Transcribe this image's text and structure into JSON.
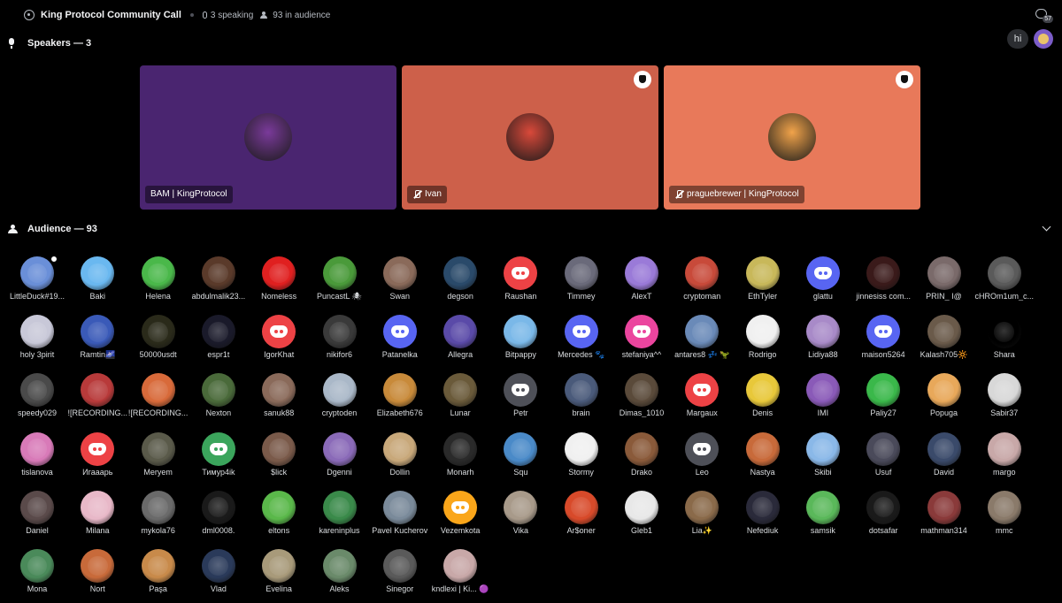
{
  "header": {
    "title": "King Protocol Community Call",
    "speaking": "3 speaking",
    "audience": "93 in audience",
    "threads_badge": "57"
  },
  "speakers": {
    "heading": "Speakers — 3",
    "hi_label": "hi",
    "tiles": [
      {
        "name": "BAM | KingProtocol",
        "muted": false,
        "moderator": false,
        "bg": "#4a2570",
        "avatar": "#7a3a9a"
      },
      {
        "name": "Ivan",
        "muted": true,
        "moderator": true,
        "bg": "#cd604a",
        "avatar": "#d9493a"
      },
      {
        "name": "praguebrewer | KingProtocol",
        "muted": true,
        "moderator": true,
        "bg": "#e8795a",
        "avatar": "#f1a34a"
      }
    ]
  },
  "audience": {
    "heading": "Audience — 93",
    "members": [
      {
        "name": "LittleDuck#19...",
        "color": "#6a8fd8",
        "discord": false
      },
      {
        "name": "Baki",
        "color": "#6ab8f0",
        "discord": false
      },
      {
        "name": "Helena",
        "color": "#4ab84a",
        "discord": false
      },
      {
        "name": "abdulmalik23...",
        "color": "#5a3a2a",
        "discord": false
      },
      {
        "name": "Nomeless",
        "color": "#e02020",
        "discord": false
      },
      {
        "name": "PuncastL 🕷",
        "color": "#4a9a3a",
        "discord": false
      },
      {
        "name": "Swan",
        "color": "#8a6a5a",
        "discord": false
      },
      {
        "name": "degson",
        "color": "#2a4a6a",
        "discord": false
      },
      {
        "name": "Raushan",
        "color": "#ed4245",
        "discord": true
      },
      {
        "name": "Timmey",
        "color": "#6a6a7a",
        "discord": false
      },
      {
        "name": "AlexT",
        "color": "#9a7ad8",
        "discord": false
      },
      {
        "name": "cryptoman",
        "color": "#c84a3a",
        "discord": false
      },
      {
        "name": "EthTyler",
        "color": "#c8b85a",
        "discord": false
      },
      {
        "name": "glattu",
        "color": "#5865f2",
        "discord": true
      },
      {
        "name": "jinnesiss com...",
        "color": "#3a1a1a",
        "discord": false
      },
      {
        "name": "PRIN_ I@",
        "color": "#7a6a6a",
        "discord": false
      },
      {
        "name": "cHROm1um_c...",
        "color": "#5a5a5a",
        "discord": false
      },
      {
        "name": "holy 3pirit",
        "color": "#c8c8d8",
        "discord": false
      },
      {
        "name": "Ramtin🌌",
        "color": "#3a5ab8",
        "discord": false
      },
      {
        "name": "50000usdt",
        "color": "#2a2a1a",
        "discord": false
      },
      {
        "name": "espr1t",
        "color": "#1a1a2a",
        "discord": false
      },
      {
        "name": "IgorKhat",
        "color": "#ed4245",
        "discord": true
      },
      {
        "name": "nikifor6",
        "color": "#3a3a3a",
        "discord": false
      },
      {
        "name": "Patanelka",
        "color": "#5865f2",
        "discord": true
      },
      {
        "name": "Allegra",
        "color": "#5a4aa8",
        "discord": false
      },
      {
        "name": "Bitpappy",
        "color": "#7ab8e8",
        "discord": false
      },
      {
        "name": "Mercedes 🐾",
        "color": "#5865f2",
        "discord": true
      },
      {
        "name": "stefaniya^^",
        "color": "#eb459e",
        "discord": true
      },
      {
        "name": "antares8 💤 🦖",
        "color": "#6a8ab8",
        "discord": false
      },
      {
        "name": "Rodrigo",
        "color": "#f0f0f0",
        "discord": false
      },
      {
        "name": "Lidiya88",
        "color": "#a88ac8",
        "discord": false
      },
      {
        "name": "maison5264",
        "color": "#5865f2",
        "discord": true
      },
      {
        "name": "Kalash705🔆",
        "color": "#6a5a4a",
        "discord": false
      },
      {
        "name": "Shara",
        "color": "#000000",
        "discord": false
      },
      {
        "name": "speedy029",
        "color": "#4a4a4a",
        "discord": false
      },
      {
        "name": "![RECORDING...",
        "color": "#b83a3a",
        "discord": false
      },
      {
        "name": "![RECORDING...",
        "color": "#d86a3a",
        "discord": false
      },
      {
        "name": "Nexton",
        "color": "#4a6a3a",
        "discord": false
      },
      {
        "name": "sanuk88",
        "color": "#8a6a5a",
        "discord": false
      },
      {
        "name": "cryptoden",
        "color": "#aab8c8",
        "discord": false
      },
      {
        "name": "Elizabeth676",
        "color": "#c88a3a",
        "discord": false
      },
      {
        "name": "Lunar",
        "color": "#6a5a3a",
        "discord": false
      },
      {
        "name": "Petr",
        "color": "#4e5058",
        "discord": true
      },
      {
        "name": "brain",
        "color": "#4a5a7a",
        "discord": false
      },
      {
        "name": "Dimas_1010",
        "color": "#5a4a3a",
        "discord": false
      },
      {
        "name": "Margaux",
        "color": "#ed4245",
        "discord": true
      },
      {
        "name": "Denis",
        "color": "#e8c83a",
        "discord": false
      },
      {
        "name": "IMI",
        "color": "#8a5ab8",
        "discord": false
      },
      {
        "name": "Paliy27",
        "color": "#3ab84a",
        "discord": false
      },
      {
        "name": "Popuga",
        "color": "#e8a85a",
        "discord": false
      },
      {
        "name": "Sabir37",
        "color": "#d8d8d8",
        "discord": false
      },
      {
        "name": "tislanova",
        "color": "#d87ab8",
        "discord": false
      },
      {
        "name": "Игааарь",
        "color": "#ed4245",
        "discord": true
      },
      {
        "name": "Meryem",
        "color": "#5a5a4a",
        "discord": false
      },
      {
        "name": "Тимур4ik",
        "color": "#3ba55c",
        "discord": true
      },
      {
        "name": "$lick",
        "color": "#7a5a4a",
        "discord": false
      },
      {
        "name": "Dgenni",
        "color": "#8a6ab8",
        "discord": false
      },
      {
        "name": "Dollin",
        "color": "#c8a87a",
        "discord": false
      },
      {
        "name": "Monarh",
        "color": "#2a2a2a",
        "discord": false
      },
      {
        "name": "Squ",
        "color": "#4a8ac8",
        "discord": false
      },
      {
        "name": "Stormy",
        "color": "#f0f0f0",
        "discord": false
      },
      {
        "name": "Drako",
        "color": "#8a5a3a",
        "discord": false
      },
      {
        "name": "Leo",
        "color": "#4e5058",
        "discord": true
      },
      {
        "name": "Nastya",
        "color": "#c86a3a",
        "discord": false
      },
      {
        "name": "Skibi",
        "color": "#8ab8e8",
        "discord": false
      },
      {
        "name": "Usuf",
        "color": "#4a4a5a",
        "discord": false
      },
      {
        "name": "David",
        "color": "#3a4a6a",
        "discord": false
      },
      {
        "name": "margo",
        "color": "#c8a8a8",
        "discord": false
      },
      {
        "name": "Daniel",
        "color": "#5a4a4a",
        "discord": false
      },
      {
        "name": "Milana",
        "color": "#e8b8c8",
        "discord": false
      },
      {
        "name": "mykola76",
        "color": "#6a6a6a",
        "discord": false
      },
      {
        "name": "dml0008.",
        "color": "#1a1a1a",
        "discord": false
      },
      {
        "name": "eltons",
        "color": "#5ab84a",
        "discord": false
      },
      {
        "name": "kareninplus",
        "color": "#3a8a4a",
        "discord": false
      },
      {
        "name": "Pavel Kucherov",
        "color": "#7a8a9a",
        "discord": false
      },
      {
        "name": "Vezemkota",
        "color": "#faa61a",
        "discord": true
      },
      {
        "name": "Vika",
        "color": "#a89a8a",
        "discord": false
      },
      {
        "name": "Ar$oner",
        "color": "#d84a2a",
        "discord": false
      },
      {
        "name": "Gleb1",
        "color": "#e8e8e8",
        "discord": false
      },
      {
        "name": "Lia✨",
        "color": "#8a6a4a",
        "discord": false
      },
      {
        "name": "Nefediuk",
        "color": "#2a2a3a",
        "discord": false
      },
      {
        "name": "samsik",
        "color": "#5ab85a",
        "discord": false
      },
      {
        "name": "dotsafar",
        "color": "#1a1a1a",
        "discord": false
      },
      {
        "name": "mathman314",
        "color": "#8a3a3a",
        "discord": false
      },
      {
        "name": "mmc",
        "color": "#8a7a6a",
        "discord": false
      },
      {
        "name": "Mona",
        "color": "#4a8a5a",
        "discord": false
      },
      {
        "name": "Nort",
        "color": "#c86a3a",
        "discord": false
      },
      {
        "name": "Paşa",
        "color": "#c88a4a",
        "discord": false
      },
      {
        "name": "Vlad",
        "color": "#2a3a5a",
        "discord": false
      },
      {
        "name": "Evelina",
        "color": "#a89a7a",
        "discord": false
      },
      {
        "name": "Aleks",
        "color": "#6a8a6a",
        "discord": false
      },
      {
        "name": "Sinegor",
        "color": "#5a5a5a",
        "discord": false
      },
      {
        "name": "kndlexi | Ki... 🟣",
        "color": "#c8a8a8",
        "discord": false
      }
    ]
  }
}
